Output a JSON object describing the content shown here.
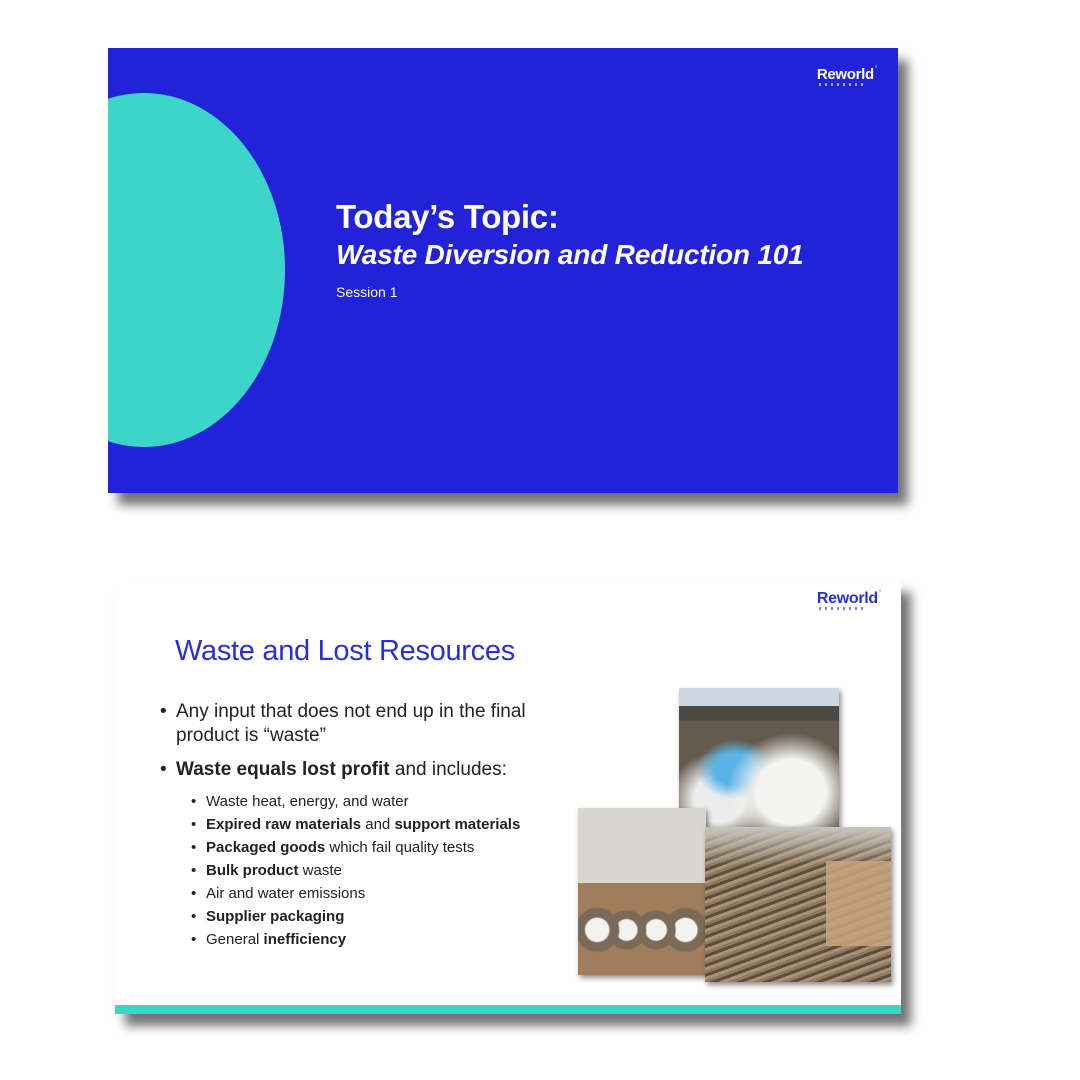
{
  "brand": "Reworld",
  "slide1": {
    "title": "Today’s Topic:",
    "subtitle": "Waste Diversion and Reduction 101",
    "session": "Session 1"
  },
  "slide2": {
    "title": "Waste and Lost Resources",
    "bullet1": "Any input that does not end up in the final product is “waste”",
    "bullet2_bold": "Waste equals lost profit",
    "bullet2_rest": " and includes:",
    "sub": {
      "s1": "Waste heat, energy, and water",
      "s2_b1": "Expired raw materials",
      "s2_t": " and ",
      "s2_b2": "support materials",
      "s3_b": "Packaged goods",
      "s3_t": " which fail quality tests",
      "s4_b": "Bulk product",
      "s4_t": " waste",
      "s5": "Air and water emissions",
      "s6_b": "Supplier packaging",
      "s7_t": "General ",
      "s7_b": "inefficiency"
    }
  },
  "colors": {
    "slide_blue": "#2222d9",
    "accent_teal": "#3cd5c7",
    "heading_blue": "#2a2fd8"
  }
}
